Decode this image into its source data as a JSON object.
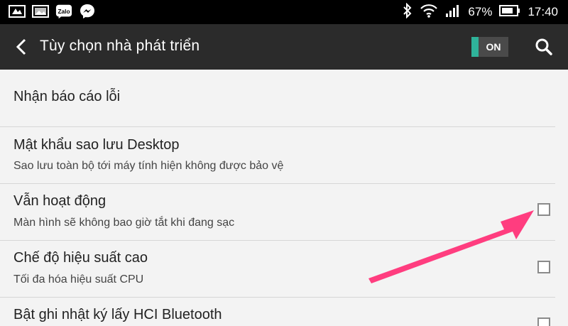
{
  "status_bar": {
    "left_icons": [
      "gallery-icon",
      "image-icon",
      "zalo-icon",
      "messenger-icon"
    ],
    "zalo_text": "Zalo",
    "battery": "67%",
    "time": "17:40"
  },
  "app_bar": {
    "title": "Tùy chọn nhà phát triển",
    "toggle_label": "ON",
    "accent_color": "#2fb39a"
  },
  "items": [
    {
      "title": "Nhận báo cáo lỗi",
      "subtitle": ""
    },
    {
      "title": "Mật khẩu sao lưu Desktop",
      "subtitle": "Sao lưu toàn bộ tới máy tính hiện không được bảo vệ"
    },
    {
      "title": "Vẫn hoạt động",
      "subtitle": "Màn hình sẽ không bao giờ tắt khi đang sạc",
      "checked": false
    },
    {
      "title": "Chế độ hiệu suất cao",
      "subtitle": "Tối đa hóa hiệu suất CPU",
      "checked": false
    },
    {
      "title": "Bật ghi nhật ký lấy HCI Bluetooth",
      "subtitle": "",
      "checked": false
    }
  ],
  "annotation_color": "#ff3d7f"
}
